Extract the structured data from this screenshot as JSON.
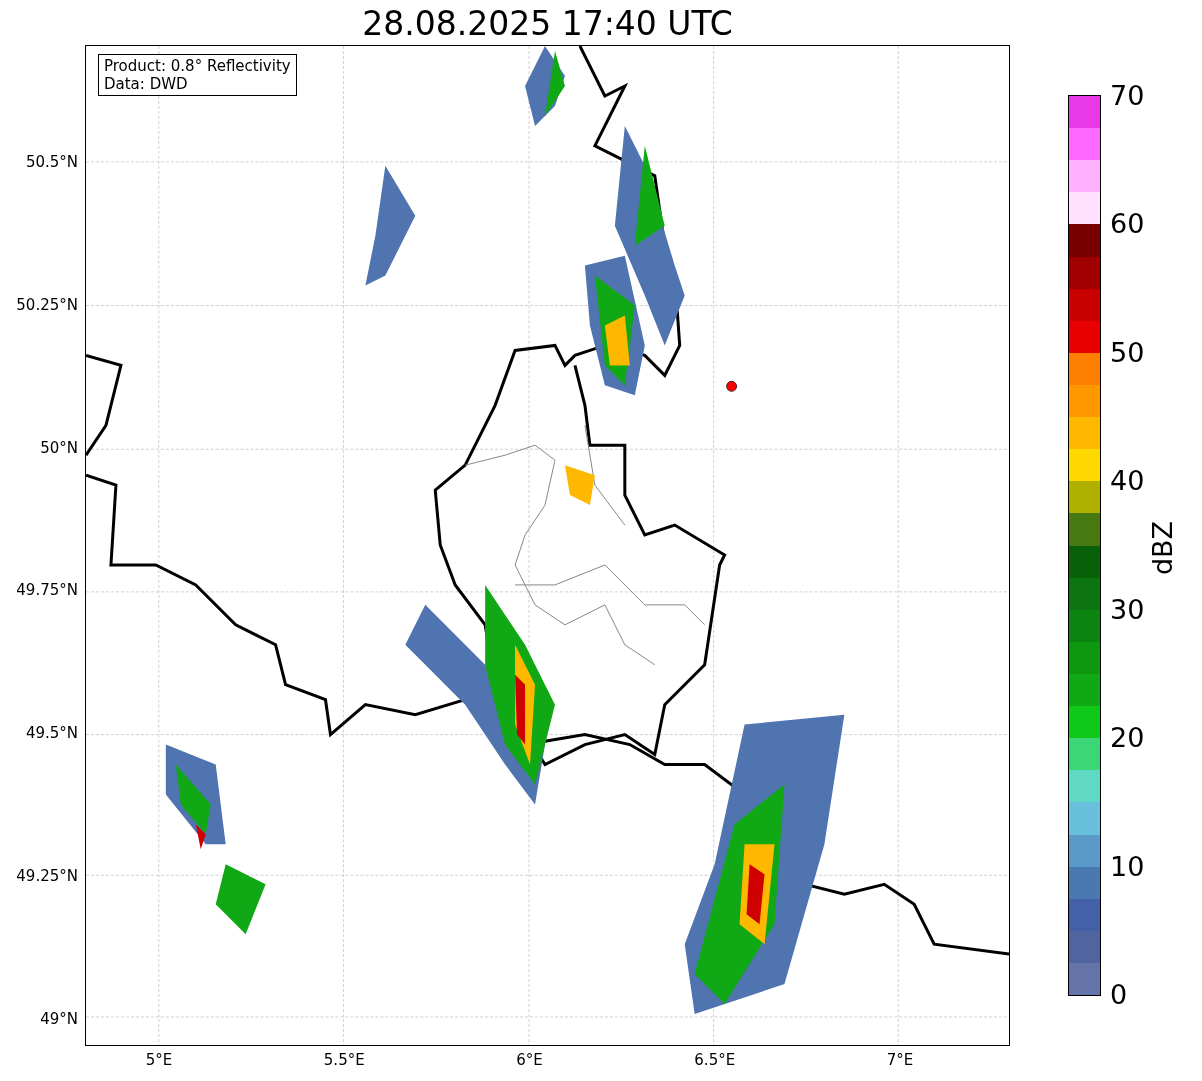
{
  "title": "28.08.2025 17:40 UTC",
  "map": {
    "info_box": [
      "Product: 0.8° Reflectivity",
      "Data: DWD"
    ],
    "y_ticks": [
      "50.5°N",
      "50.25°N",
      "50°N",
      "49.75°N",
      "49.5°N",
      "49.25°N",
      "49°N"
    ],
    "x_ticks": [
      "5°E",
      "5.5°E",
      "6°E",
      "6.5°E",
      "7°E"
    ]
  },
  "colorbar": {
    "label": "dBZ",
    "ticks": [
      "70",
      "60",
      "50",
      "40",
      "30",
      "20",
      "10",
      "0"
    ],
    "bins": [
      {
        "color": "#e838e8"
      },
      {
        "color": "#ff68ff"
      },
      {
        "color": "#ffb0ff"
      },
      {
        "color": "#ffe0ff"
      },
      {
        "color": "#780000"
      },
      {
        "color": "#a00000"
      },
      {
        "color": "#c80000"
      },
      {
        "color": "#e80000"
      },
      {
        "color": "#ff8000"
      },
      {
        "color": "#ff9800"
      },
      {
        "color": "#ffb800"
      },
      {
        "color": "#ffd800"
      },
      {
        "color": "#b0b000"
      },
      {
        "color": "#487810"
      },
      {
        "color": "#086008"
      },
      {
        "color": "#0c7410"
      },
      {
        "color": "#0c8410"
      },
      {
        "color": "#0e9810"
      },
      {
        "color": "#10a814"
      },
      {
        "color": "#10c818"
      },
      {
        "color": "#3dd676"
      },
      {
        "color": "#5fd8c4"
      },
      {
        "color": "#68c0dc"
      },
      {
        "color": "#5a9ac8"
      },
      {
        "color": "#4a78b0"
      },
      {
        "color": "#4460a8"
      },
      {
        "color": "#5065a0"
      },
      {
        "color": "#6474a8"
      }
    ]
  }
}
